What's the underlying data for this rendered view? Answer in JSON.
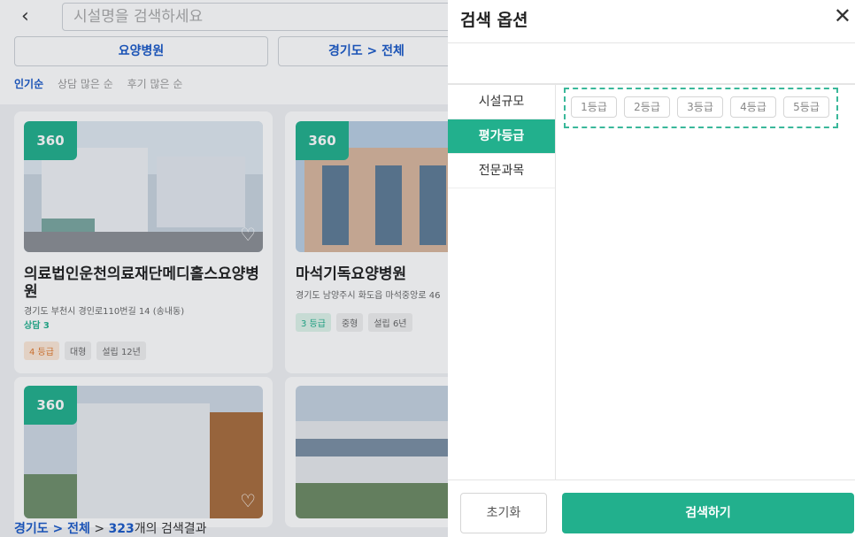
{
  "list": {
    "search_placeholder": "시설명을 검색하세요",
    "filter_type": "요양병원",
    "filter_region": "경기도 > 전체",
    "sorts": [
      "인기순",
      "상담 많은 순",
      "후기 많은 순"
    ],
    "cards": [
      {
        "name": "의료법인운천의료재단메디홀스요양병원",
        "address": "경기도 부천시 경인로110번길 14 (송내동)",
        "consult": "상담 3",
        "tags": [
          "4 등급",
          "대형",
          "설립 12년"
        ]
      },
      {
        "name": "마석기독요양병원",
        "address": "경기도 남양주시 화도읍 마석중앙로 46",
        "tags": [
          "3 등급",
          "중형",
          "설립 6년"
        ]
      }
    ],
    "badge360": "360",
    "bottom": {
      "region": "경기도 > 전체",
      "sep": " > ",
      "count": "323",
      "suffix": "개의 검색결과"
    }
  },
  "panel": {
    "title": "검색 옵션",
    "categories": [
      "시설규모",
      "평가등급",
      "전문과목"
    ],
    "active_category": "평가등급",
    "grades": [
      "1등급",
      "2등급",
      "3등급",
      "4등급",
      "5등급"
    ],
    "reset_label": "초기화",
    "search_label": "검색하기"
  },
  "colors": {
    "accent": "#22b08d",
    "link": "#1a59c8"
  }
}
